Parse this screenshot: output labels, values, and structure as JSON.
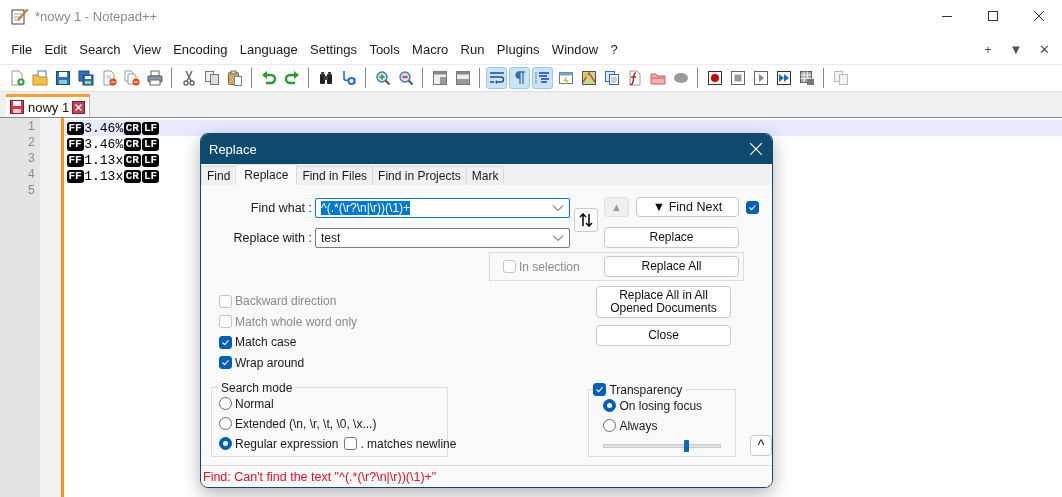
{
  "window": {
    "title": "*nowy 1 - Notepad++"
  },
  "menu": {
    "items": [
      "File",
      "Edit",
      "Search",
      "View",
      "Encoding",
      "Language",
      "Settings",
      "Tools",
      "Macro",
      "Run",
      "Plugins",
      "Window",
      "?"
    ],
    "right": [
      "+",
      "▼",
      "✕"
    ]
  },
  "toolbar": {
    "groups": [
      [
        {
          "kind": "new",
          "pressed": false
        },
        {
          "kind": "open",
          "pressed": false
        },
        {
          "kind": "save",
          "pressed": false
        },
        {
          "kind": "saveall",
          "pressed": false
        },
        {
          "kind": "close",
          "pressed": false
        },
        {
          "kind": "closeall",
          "pressed": false
        },
        {
          "kind": "print",
          "pressed": false
        }
      ],
      [
        {
          "kind": "cut",
          "pressed": false
        },
        {
          "kind": "copy",
          "pressed": false
        },
        {
          "kind": "paste",
          "pressed": false
        }
      ],
      [
        {
          "kind": "undo",
          "pressed": false
        },
        {
          "kind": "redo",
          "pressed": false
        }
      ],
      [
        {
          "kind": "find",
          "pressed": false
        },
        {
          "kind": "replace",
          "pressed": false
        }
      ],
      [
        {
          "kind": "zoomin",
          "pressed": false
        },
        {
          "kind": "zoomout",
          "pressed": false
        }
      ],
      [
        {
          "kind": "syncv",
          "pressed": false
        },
        {
          "kind": "synch",
          "pressed": false
        }
      ],
      [
        {
          "kind": "wrap",
          "pressed": true
        },
        {
          "kind": "allchars",
          "pressed": true
        },
        {
          "kind": "indent",
          "pressed": true
        },
        {
          "kind": "udl",
          "pressed": false
        },
        {
          "kind": "map",
          "pressed": false
        },
        {
          "kind": "doclist",
          "pressed": false
        },
        {
          "kind": "funclist",
          "pressed": false
        },
        {
          "kind": "folder",
          "pressed": false
        },
        {
          "kind": "oval",
          "pressed": false
        }
      ],
      [
        {
          "kind": "record",
          "pressed": false
        },
        {
          "kind": "stop",
          "pressed": false
        },
        {
          "kind": "play",
          "pressed": false
        },
        {
          "kind": "playmulti",
          "pressed": false
        },
        {
          "kind": "savemacro",
          "pressed": false
        }
      ],
      [
        {
          "kind": "pastedisabled",
          "pressed": false
        }
      ]
    ]
  },
  "tabs": [
    {
      "label": "nowy 1",
      "selected": true,
      "modified": true
    }
  ],
  "editor": {
    "lines": [
      {
        "number": "1",
        "current": true,
        "tokens": [
          {
            "kind": "control",
            "text": "FF"
          },
          {
            "kind": "text",
            "text": "3.46%"
          },
          {
            "kind": "control",
            "text": "CR"
          },
          {
            "kind": "control",
            "text": "LF"
          }
        ]
      },
      {
        "number": "2",
        "current": false,
        "tokens": [
          {
            "kind": "control",
            "text": "FF"
          },
          {
            "kind": "text",
            "text": "3.46%"
          },
          {
            "kind": "control",
            "text": "CR"
          },
          {
            "kind": "control",
            "text": "LF"
          }
        ]
      },
      {
        "number": "3",
        "current": false,
        "tokens": [
          {
            "kind": "control",
            "text": "FF"
          },
          {
            "kind": "text",
            "text": "1.13x"
          },
          {
            "kind": "control",
            "text": "CR"
          },
          {
            "kind": "control",
            "text": "LF"
          }
        ]
      },
      {
        "number": "4",
        "current": false,
        "tokens": [
          {
            "kind": "control",
            "text": "FF"
          },
          {
            "kind": "text",
            "text": "1.13x"
          },
          {
            "kind": "control",
            "text": "CR"
          },
          {
            "kind": "control",
            "text": "LF"
          }
        ]
      },
      {
        "number": "5",
        "current": false
      }
    ]
  },
  "dialog": {
    "title": "Replace",
    "tabs": [
      {
        "label": "Find",
        "selected": false
      },
      {
        "label": "Replace",
        "selected": true
      },
      {
        "label": "Find in Files",
        "selected": false
      },
      {
        "label": "Find in Projects",
        "selected": false
      },
      {
        "label": "Mark",
        "selected": false
      }
    ],
    "fields": [
      {
        "label": "Find what :",
        "value": "^(.*(\\r?\\n|\\r))(\\1)+",
        "text_selected": true
      },
      {
        "label": "Replace with :",
        "value": "test",
        "text_selected": false
      }
    ],
    "up_button": {
      "label": "▲",
      "disabled": true
    },
    "find_next_checkbox": {
      "checked": true
    },
    "buttons": [
      {
        "label": "▼ Find Next"
      },
      {
        "label": "Replace"
      },
      {
        "label": "Replace All"
      },
      {
        "label": "Replace All in All Opened Documents"
      },
      {
        "label": "Close"
      }
    ],
    "in_selection": {
      "label": "In selection",
      "checked": false,
      "disabled": true
    },
    "options": [
      {
        "label": "Backward direction",
        "checked": false,
        "disabled": true
      },
      {
        "label": "Match whole word only",
        "checked": false,
        "disabled": true
      },
      {
        "label": "Match case",
        "checked": true,
        "disabled": false
      },
      {
        "label": "Wrap around",
        "checked": true,
        "disabled": false
      }
    ],
    "search_mode": {
      "title": "Search mode",
      "modes": [
        {
          "label": "Normal",
          "selected": false
        },
        {
          "label": "Extended (\\n, \\r, \\t, \\0, \\x...)",
          "selected": false
        },
        {
          "label": "Regular expression",
          "selected": true
        }
      ],
      "dot_newline": {
        "label": ". matches newline",
        "checked": false
      }
    },
    "transparency": {
      "label": "Transparency",
      "checked": true,
      "modes": [
        {
          "label": "On losing focus",
          "selected": true
        },
        {
          "label": "Always",
          "selected": false
        }
      ],
      "level": 0.7
    },
    "collapse_button": "^",
    "status": "Find: Can't find the text \"^(.*(\\r?\\n|\\r))(\\1)+\""
  }
}
